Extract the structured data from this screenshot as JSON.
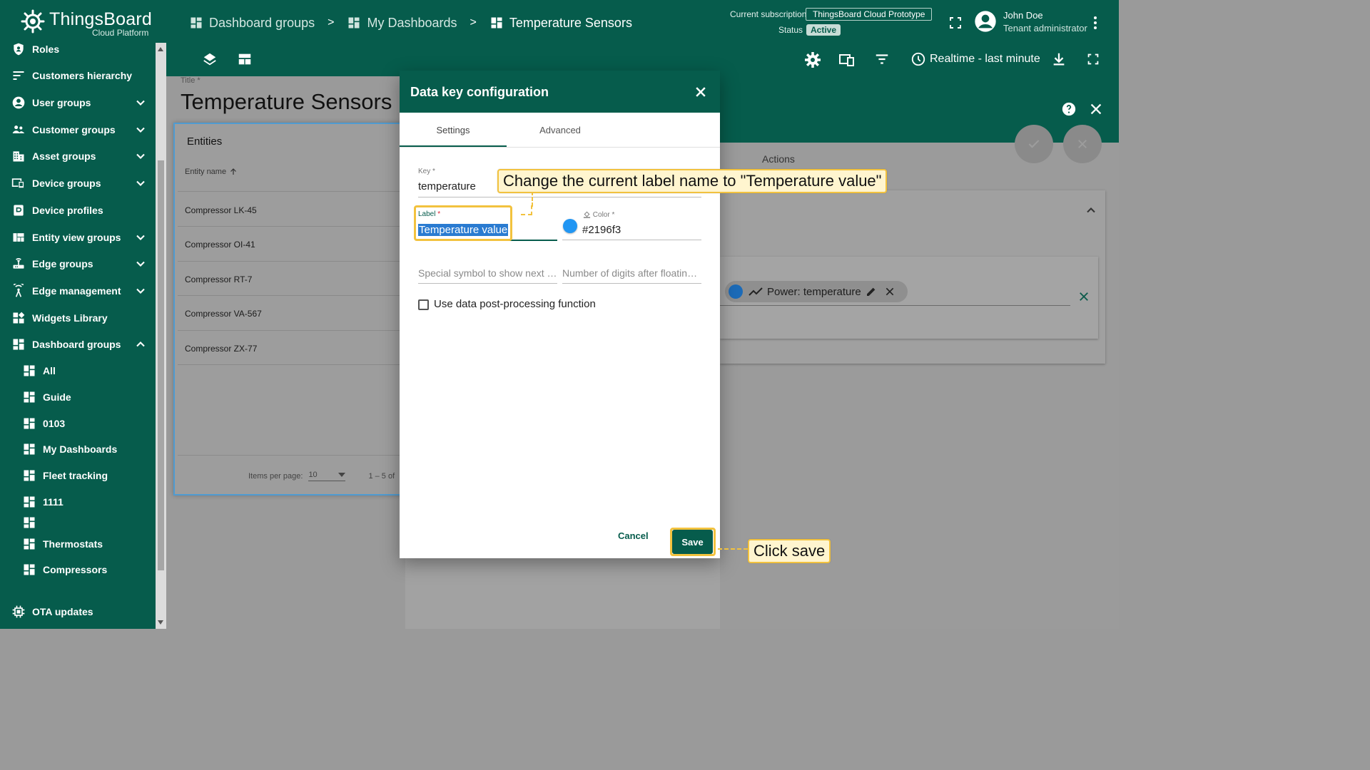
{
  "brand": {
    "name": "ThingsBoard",
    "subtitle": "Cloud Platform",
    "primary_color": "#065c4c",
    "highlight_color": "#f2c23e"
  },
  "sidebar": {
    "items": [
      {
        "label": "Roles",
        "icon": "shield-icon"
      },
      {
        "label": "Customers hierarchy",
        "icon": "sort-lines-icon"
      },
      {
        "label": "User groups",
        "icon": "account-circle-icon",
        "expandable": true
      },
      {
        "label": "Customer groups",
        "icon": "people-icon",
        "expandable": true
      },
      {
        "label": "Asset groups",
        "icon": "building-icon",
        "expandable": true
      },
      {
        "label": "Device groups",
        "icon": "devices-icon",
        "expandable": true
      },
      {
        "label": "Device profiles",
        "icon": "device-profile-icon"
      },
      {
        "label": "Entity view groups",
        "icon": "view-quilt-icon",
        "expandable": true
      },
      {
        "label": "Edge groups",
        "icon": "router-icon",
        "expandable": true
      },
      {
        "label": "Edge management",
        "icon": "wifi-tower-icon",
        "expandable": true
      },
      {
        "label": "Widgets Library",
        "icon": "widgets-icon"
      },
      {
        "label": "Dashboard groups",
        "icon": "dashboard-icon",
        "expanded": true
      }
    ],
    "dashboard_subitems": [
      "All",
      "Guide",
      "0103",
      "My Dashboards",
      "Fleet tracking",
      "1111",
      "",
      "Thermostats",
      "Compressors"
    ],
    "bottom_item": {
      "label": "OTA updates",
      "icon": "memory-chip-icon"
    }
  },
  "header": {
    "breadcrumbs": [
      "Dashboard groups",
      "My Dashboards",
      "Temperature Sensors"
    ],
    "separator": ">",
    "subscription_label": "Current subscription",
    "subscription_value": "ThingsBoard Cloud Prototype",
    "status_label": "Status",
    "status_value": "Active",
    "user_name": "John Doe",
    "user_role": "Tenant administrator",
    "realtime_label": "Realtime - last minute"
  },
  "dashboard": {
    "title_label": "Title *",
    "title": "Temperature Sensors",
    "entities_widget": {
      "title": "Entities",
      "column_header": "Entity name",
      "rows": [
        "Compressor LK-45",
        "Compressor OI-41",
        "Compressor RT-7",
        "Compressor VA-567",
        "Compressor ZX-77"
      ],
      "items_per_page_label": "Items per page:",
      "items_per_page_value": "10",
      "range_text": "1 – 5 of"
    }
  },
  "widget_editor": {
    "actions_label": "Actions",
    "datakey_chip": {
      "prefix": "Power: ",
      "key": "temperature"
    }
  },
  "dialog": {
    "title": "Data key configuration",
    "tabs": [
      "Settings",
      "Advanced"
    ],
    "active_tab": "Settings",
    "key_label": "Key",
    "key_value": "temperature",
    "label_label": "Label",
    "label_value": "Temperature value",
    "color_label": "Color",
    "color_value": "#2196f3",
    "color_display": "#2196f3",
    "units_placeholder": "Special symbol to show next to value",
    "decimals_placeholder": "Number of digits after floating point",
    "postprocessing_label": "Use data post-processing function",
    "postprocessing_checked": false,
    "cancel_label": "Cancel",
    "save_label": "Save"
  },
  "tutorial": {
    "label_hint": "Change the current label name to \"Temperature value\"",
    "save_hint": "Click save"
  }
}
